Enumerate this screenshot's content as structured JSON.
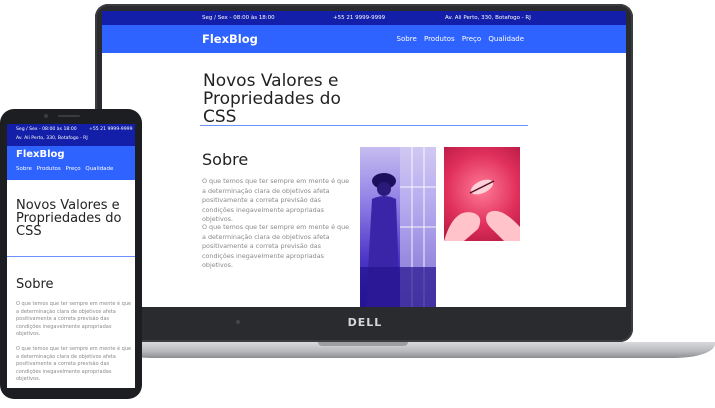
{
  "device_brand": "DELL",
  "site": {
    "topbar": {
      "hours": "Seg / Sex - 08:00 às 18:00",
      "phone": "+55 21 9999-9999",
      "address": "Av. Ali Perto, 330, Botafogo - RJ"
    },
    "brand": "FlexBlog",
    "menu": [
      "Sobre",
      "Produtos",
      "Preço",
      "Qualidade"
    ],
    "hero_title": "Novos Valores e Propriedades do CSS",
    "section_title": "Sobre",
    "paragraphs": [
      "O que temos que ter sempre em mente é que a determinação clara de objetivos afeta positivamente a correta previsão das condições inegavelmente apropriadas objetivos.",
      "O que temos que ter sempre em mente é que a determinação clara de objetivos afeta positivamente a correta previsão das condições inegavelmente apropriadas objetivos."
    ]
  },
  "colors": {
    "topbar": "#131fa8",
    "nav": "#2e63ff",
    "divider": "#6e90ff",
    "text": "#8a8a8a"
  }
}
